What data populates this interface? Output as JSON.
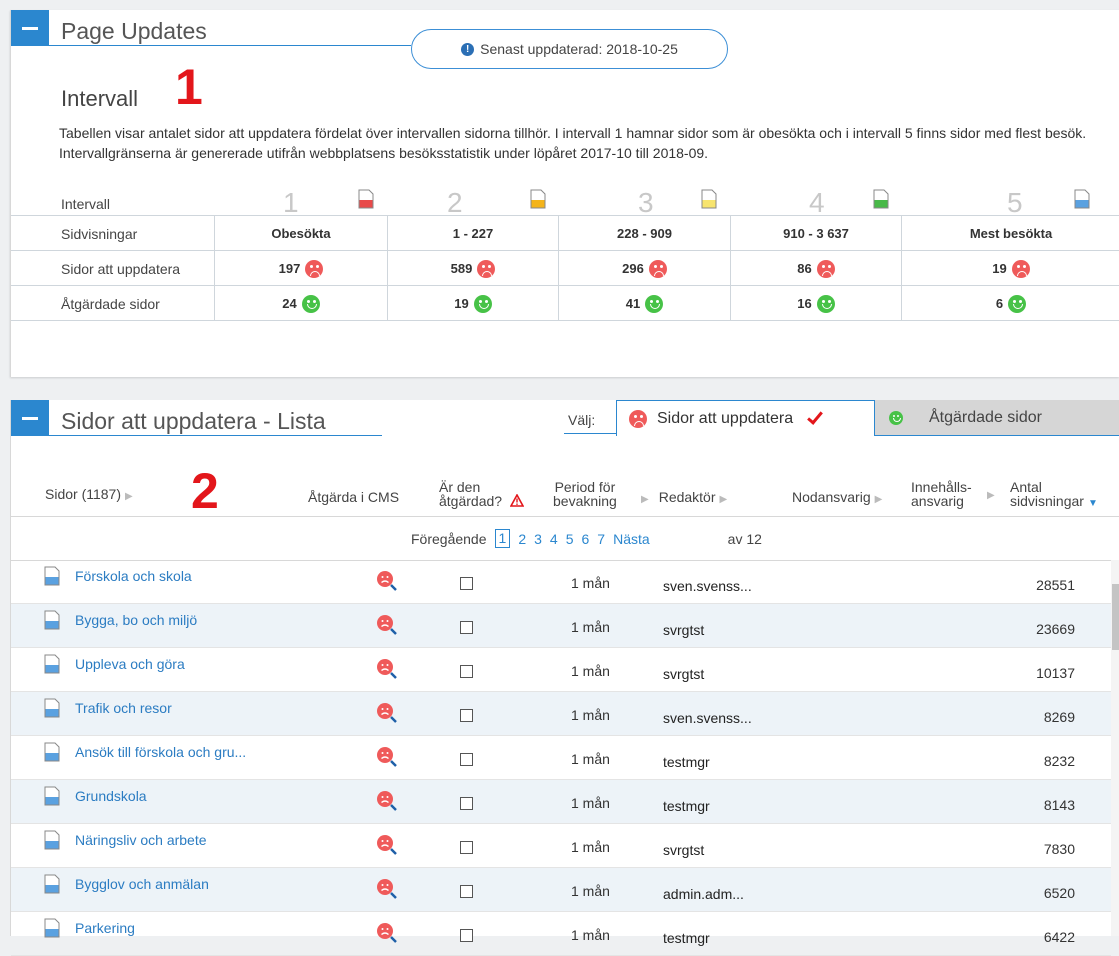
{
  "panel1": {
    "title": "Page Updates",
    "updated_label": "Senast uppdaterad: 2018-10-25",
    "heading": "Intervall",
    "marker": "1",
    "description": "Tabellen visar antalet sidor att uppdatera fördelat över intervallen sidorna tillhör. I intervall 1 hamnar sidor som är obesökta och i intervall 5 finns sidor med flest besök. Intervallgränserna är genererade utifrån webbplatsens besöksstatistik under löpåret 2017-10 till 2018-09.",
    "interval_label": "Intervall",
    "intervals": [
      {
        "num": "1",
        "color": "#e84a4a",
        "range": "Obesökta",
        "to_update": "197",
        "fixed": "24"
      },
      {
        "num": "2",
        "color": "#f4b41a",
        "range": "1 - 227",
        "to_update": "589",
        "fixed": "19"
      },
      {
        "num": "3",
        "color": "#f7e46e",
        "range": "228 - 909",
        "to_update": "296",
        "fixed": "41"
      },
      {
        "num": "4",
        "color": "#48b948",
        "range": "910 - 3 637",
        "to_update": "86",
        "fixed": "16"
      },
      {
        "num": "5",
        "color": "#5aa1e0",
        "range": "Mest besökta",
        "to_update": "19",
        "fixed": "6"
      }
    ],
    "row_labels": {
      "views": "Sidvisningar",
      "to_update": "Sidor att uppdatera",
      "fixed": "Åtgärdade sidor"
    }
  },
  "panel2": {
    "title": "Sidor att uppdatera - Lista",
    "select_label": "Välj:",
    "tab_active": "Sidor att uppdatera",
    "tab_inactive": "Åtgärdade sidor",
    "marker": "2",
    "columns": {
      "pages": "Sidor (1187)",
      "action": "Åtgärda i CMS",
      "done_1": "Är den",
      "done_2": "åtgärdad?",
      "period_1": "Period för",
      "period_2": "bevakning",
      "editor": "Redaktör",
      "node": "Nodansvarig",
      "content_1": "Innehålls-",
      "content_2": "ansvarig",
      "views_1": "Antal",
      "views_2": "sidvisningar"
    },
    "pager": {
      "prev": "Föregående",
      "pages": [
        "1",
        "2",
        "3",
        "4",
        "5",
        "6",
        "7"
      ],
      "current": "1",
      "next": "Nästa",
      "of": "av 12"
    },
    "rows": [
      {
        "name": "Förskola och skola",
        "period": "1 mån",
        "editor": "sven.svenss...",
        "views": "28551"
      },
      {
        "name": "Bygga, bo och miljö",
        "period": "1 mån",
        "editor": "svrgtst",
        "views": "23669"
      },
      {
        "name": "Uppleva och göra",
        "period": "1 mån",
        "editor": "svrgtst",
        "views": "10137"
      },
      {
        "name": "Trafik och resor",
        "period": "1 mån",
        "editor": "sven.svenss...",
        "views": "8269"
      },
      {
        "name": "Ansök till förskola och gru...",
        "period": "1 mån",
        "editor": "testmgr",
        "views": "8232"
      },
      {
        "name": "Grundskola",
        "period": "1 mån",
        "editor": "testmgr",
        "views": "8143"
      },
      {
        "name": "Näringsliv och arbete",
        "period": "1 mån",
        "editor": "svrgtst",
        "views": "7830"
      },
      {
        "name": "Bygglov och anmälan",
        "period": "1 mån",
        "editor": "admin.adm...",
        "views": "6520"
      },
      {
        "name": "Parkering",
        "period": "1 mån",
        "editor": "testmgr",
        "views": "6422"
      }
    ]
  }
}
